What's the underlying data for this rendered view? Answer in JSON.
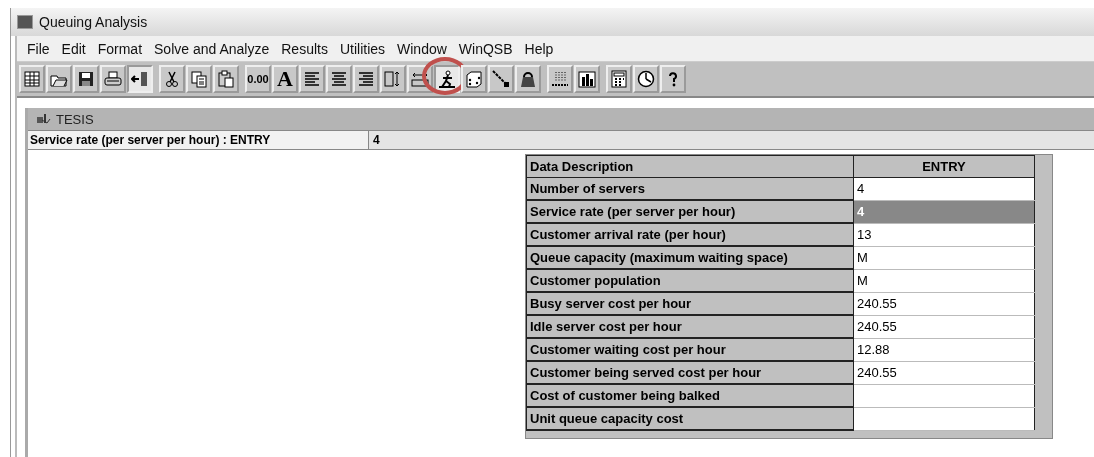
{
  "window": {
    "title": "Queuing Analysis"
  },
  "menu": [
    "File",
    "Edit",
    "Format",
    "Solve and Analyze",
    "Results",
    "Utilities",
    "Window",
    "WinQSB",
    "Help"
  ],
  "toolbar": [
    [
      {
        "kind": "grid",
        "pressed": false
      },
      {
        "kind": "open",
        "pressed": false
      },
      {
        "kind": "save",
        "pressed": false
      },
      {
        "kind": "print",
        "pressed": false
      },
      {
        "kind": "exit",
        "pressed": true
      }
    ],
    [
      {
        "kind": "cut",
        "pressed": false
      },
      {
        "kind": "copy",
        "pressed": false
      },
      {
        "kind": "paste",
        "pressed": false
      }
    ],
    [
      {
        "kind": "text",
        "label": "0.00",
        "pressed": false
      },
      {
        "kind": "font",
        "label": "A",
        "pressed": false
      },
      {
        "kind": "align-left",
        "pressed": false
      },
      {
        "kind": "align-center",
        "pressed": false
      },
      {
        "kind": "align-right",
        "pressed": false
      },
      {
        "kind": "row-height",
        "pressed": false
      },
      {
        "kind": "col-width",
        "pressed": false
      },
      {
        "kind": "run",
        "pressed": true,
        "highlighted": true
      },
      {
        "kind": "dice",
        "pressed": false
      },
      {
        "kind": "diagonal",
        "pressed": false
      },
      {
        "kind": "bag",
        "pressed": false
      }
    ],
    [
      {
        "kind": "dots",
        "pressed": false
      },
      {
        "kind": "bars",
        "pressed": false
      }
    ],
    [
      {
        "kind": "calculator",
        "pressed": false
      },
      {
        "kind": "clock",
        "pressed": false
      },
      {
        "kind": "help",
        "pressed": false
      }
    ]
  ],
  "child_window": {
    "title": "TESIS",
    "entry_bar": {
      "label": "Service rate (per server per hour) : ENTRY",
      "value": "4"
    },
    "table": {
      "columns": [
        "Data Description",
        "ENTRY"
      ],
      "rows": [
        {
          "description": "Number of servers",
          "entry": "4",
          "selected": false
        },
        {
          "description": "Service rate (per server per hour)",
          "entry": "4",
          "selected": true
        },
        {
          "description": "Customer arrival rate (per hour)",
          "entry": "13",
          "selected": false
        },
        {
          "description": "Queue capacity (maximum waiting space)",
          "entry": "M",
          "selected": false
        },
        {
          "description": "Customer population",
          "entry": "M",
          "selected": false
        },
        {
          "description": "Busy server cost per hour",
          "entry": "240.55",
          "selected": false
        },
        {
          "description": "Idle server cost per hour",
          "entry": "240.55",
          "selected": false
        },
        {
          "description": "Customer waiting cost per hour",
          "entry": "12.88",
          "selected": false
        },
        {
          "description": "Customer being served cost per hour",
          "entry": "240.55",
          "selected": false
        },
        {
          "description": "Cost of customer being balked",
          "selected": false
        },
        {
          "description": "Unit queue capacity cost",
          "selected": false
        }
      ]
    }
  }
}
